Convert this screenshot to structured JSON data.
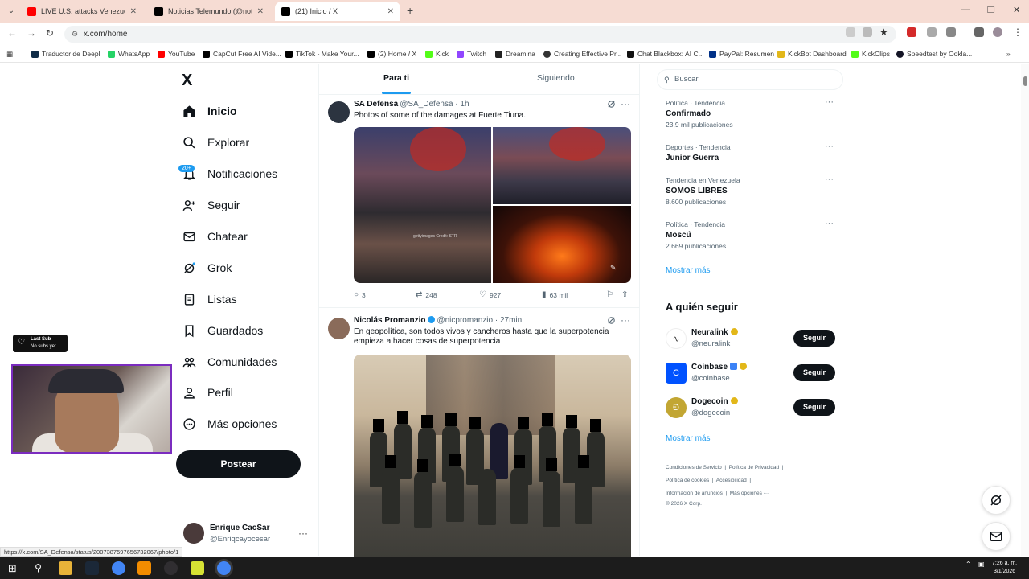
{
  "browser": {
    "tabs": [
      {
        "title": "LIVE U.S. attacks Venezuela, Tru",
        "color": "#ff0000"
      },
      {
        "title": "Noticias Telemundo (@noticias",
        "color": "#000000"
      },
      {
        "title": "(21) Inicio / X",
        "color": "#000000"
      }
    ],
    "new_tab": "+",
    "url": "x.com/home",
    "bookmarks": [
      {
        "label": "Traductor de Deepl",
        "color": "#0f2b46"
      },
      {
        "label": "WhatsApp",
        "color": "#25d366"
      },
      {
        "label": "YouTube",
        "color": "#ff0000"
      },
      {
        "label": "CapCut Free AI Vide...",
        "color": "#000000"
      },
      {
        "label": "TikTok - Make Your...",
        "color": "#000000"
      },
      {
        "label": "(2) Home / X",
        "color": "#000000"
      },
      {
        "label": "Kick",
        "color": "#53fc18"
      },
      {
        "label": "Twitch",
        "color": "#9146ff"
      },
      {
        "label": "Dreamina",
        "color": "#222222"
      },
      {
        "label": "Creating Effective Pr...",
        "color": "#333333"
      },
      {
        "label": "Chat Blackbox: AI C...",
        "color": "#111111"
      },
      {
        "label": "PayPal: Resumen",
        "color": "#003087"
      },
      {
        "label": "KickBot Dashboard",
        "color": "#e2b719"
      },
      {
        "label": "KickClips",
        "color": "#53fc18"
      },
      {
        "label": "Speedtest by Ookla...",
        "color": "#141526"
      }
    ]
  },
  "nav": {
    "logo": "X",
    "badge": "20+",
    "items": [
      {
        "label": "Inicio",
        "icon": "home-icon"
      },
      {
        "label": "Explorar",
        "icon": "search-icon"
      },
      {
        "label": "Notificaciones",
        "icon": "bell-icon"
      },
      {
        "label": "Seguir",
        "icon": "follow-icon"
      },
      {
        "label": "Chatear",
        "icon": "mail-icon"
      },
      {
        "label": "Grok",
        "icon": "grok-icon"
      },
      {
        "label": "Listas",
        "icon": "list-icon"
      },
      {
        "label": "Guardados",
        "icon": "bookmark-icon"
      },
      {
        "label": "Comunidades",
        "icon": "communities-icon"
      },
      {
        "label": "Perfil",
        "icon": "profile-icon"
      },
      {
        "label": "Más opciones",
        "icon": "more-icon"
      }
    ],
    "post_button": "Postear",
    "account": {
      "name": "Enrique CacSar",
      "handle": "@Enriqcayocesar"
    }
  },
  "overlay": {
    "last_sub": "Last Sub",
    "no_subs": "No subs yet"
  },
  "feed": {
    "tabs": [
      "Para ti",
      "Siguiendo"
    ],
    "posts": [
      {
        "name": "SA Defensa",
        "handle": "@SA_Defensa · 1h",
        "text": "Photos of some of the damages at Fuerte Tiuna.",
        "replies": "3",
        "reposts": "248",
        "likes": "927",
        "views": "63 mil",
        "media_credit": "gettyimages Credit: STR"
      },
      {
        "name": "Nicolás Promanzio",
        "handle": "@nicpromanzio · 27min",
        "text": "En geopolítica, son todos vivos y cancheros hasta que la superpotencia empieza a hacer cosas de superpotencia"
      }
    ]
  },
  "right": {
    "search_placeholder": "Buscar",
    "trends": [
      {
        "meta": "Política · Tendencia",
        "title": "Confirmado",
        "count": "23,9 mil publicaciones"
      },
      {
        "meta": "Deportes · Tendencia",
        "title": "Junior Guerra",
        "count": ""
      },
      {
        "meta": "Tendencia en Venezuela",
        "title": "SOMOS LIBRES",
        "count": "8.600 publicaciones"
      },
      {
        "meta": "Política · Tendencia",
        "title": "Moscú",
        "count": "2.669 publicaciones"
      }
    ],
    "show_more": "Mostrar más",
    "who_to_follow": "A quién seguir",
    "suggestions": [
      {
        "name": "Neuralink",
        "handle": "@neuralink",
        "button": "Seguir"
      },
      {
        "name": "Coinbase",
        "handle": "@coinbase",
        "button": "Seguir"
      },
      {
        "name": "Dogecoin",
        "handle": "@dogecoin",
        "button": "Seguir"
      }
    ],
    "footer": [
      [
        "Condiciones de Servicio",
        "Política de Privacidad"
      ],
      [
        "Política de cookies",
        "Accesibilidad"
      ],
      [
        "Información de anuncios",
        "Más opciones ···"
      ],
      [
        "© 2026 X Corp."
      ]
    ]
  },
  "status_url": "https://x.com/SA_Defensa/status/2007387597656732067/photo/1",
  "taskbar": {
    "time": "7:26 a. m.",
    "date": "3/1/2026"
  },
  "colors": {
    "accent": "#1d9bf0",
    "text": "#0f1419",
    "muted": "#536471"
  }
}
